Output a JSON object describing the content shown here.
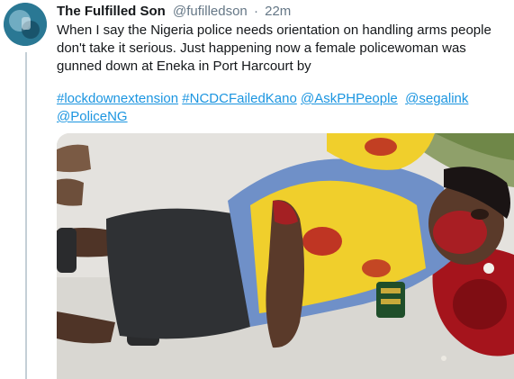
{
  "tweet": {
    "display_name": "The Fulfilled Son",
    "handle": "@fufilledson",
    "separator": "·",
    "time": "22m",
    "text_lines": [
      "When I say the Nigeria police needs orientation on handling arms people",
      "don't take it serious.  Just happening now a female policewoman was",
      "gunned down at Eneka in Port Harcourt by"
    ],
    "hashtags": {
      "tag1": "#lockdownextension",
      "tag2": "#NCDCFailedKano",
      "mention1": "@AskPHPeople",
      "mention2": "@segalink",
      "mention3": "@PoliceNG"
    }
  },
  "colors": {
    "text": "#14171a",
    "muted": "#657786",
    "link": "#1b95e0",
    "thread_line": "#c4cfd6",
    "uniform_vest": "#f0cf2c",
    "uniform_shirt": "#6f90c8",
    "skirt": "#2f3134",
    "blood": "#b61a22"
  },
  "icons": {
    "avatar": "profile-photo"
  }
}
